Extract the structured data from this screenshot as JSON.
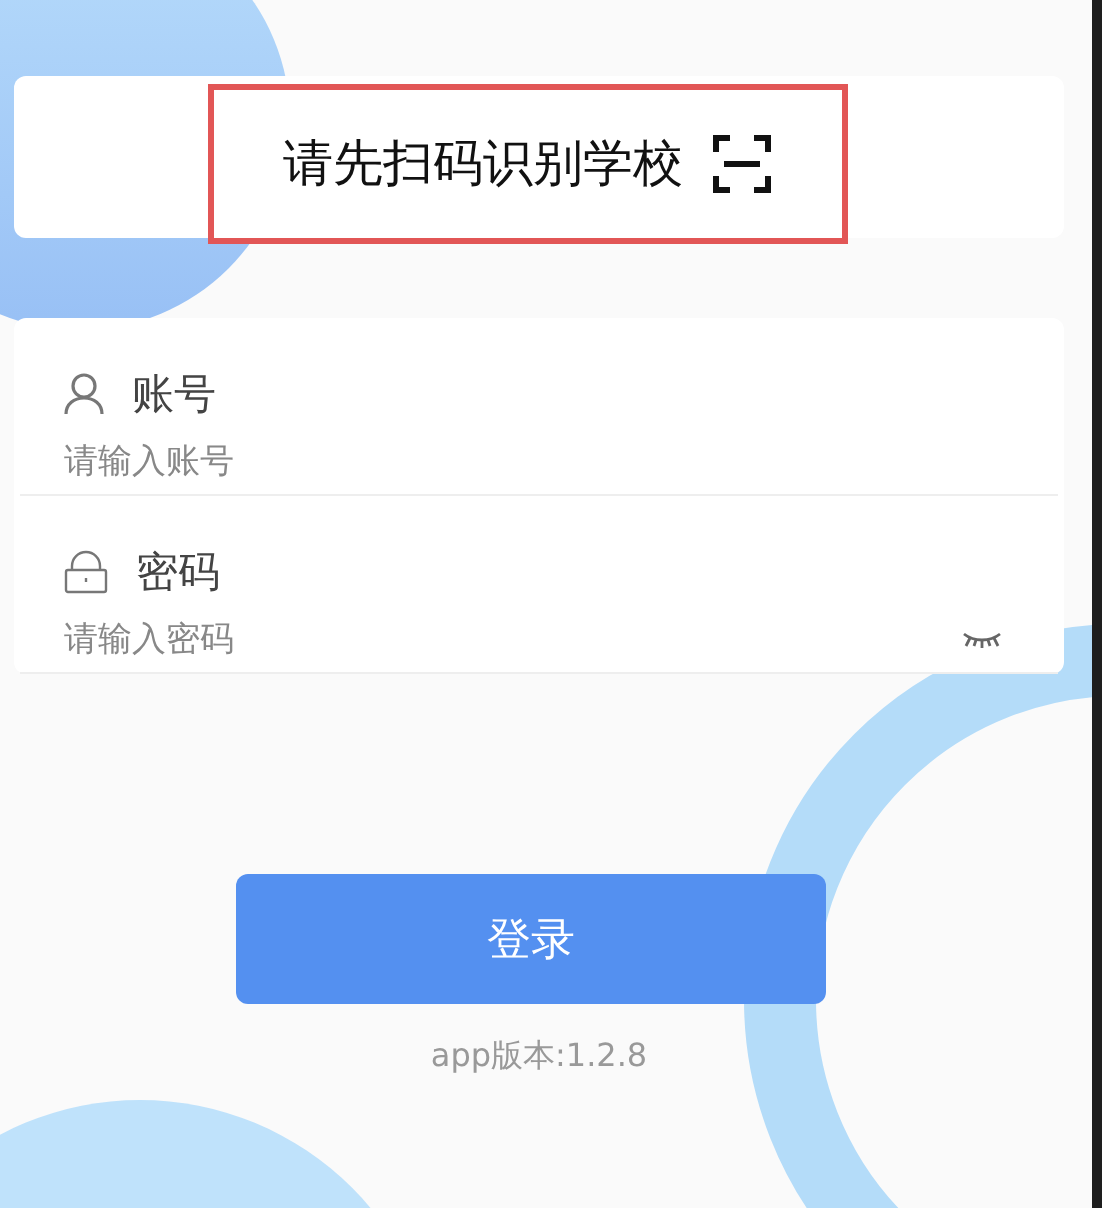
{
  "school_scan": {
    "label": "请先扫码识别学校",
    "highlighted": true
  },
  "fields": [
    {
      "kind": "account",
      "label": "账号",
      "placeholder": "请输入账号"
    },
    {
      "kind": "password",
      "label": "密码",
      "placeholder": "请输入密码"
    }
  ],
  "login_button": "登录",
  "version": "app版本:1.2.8"
}
